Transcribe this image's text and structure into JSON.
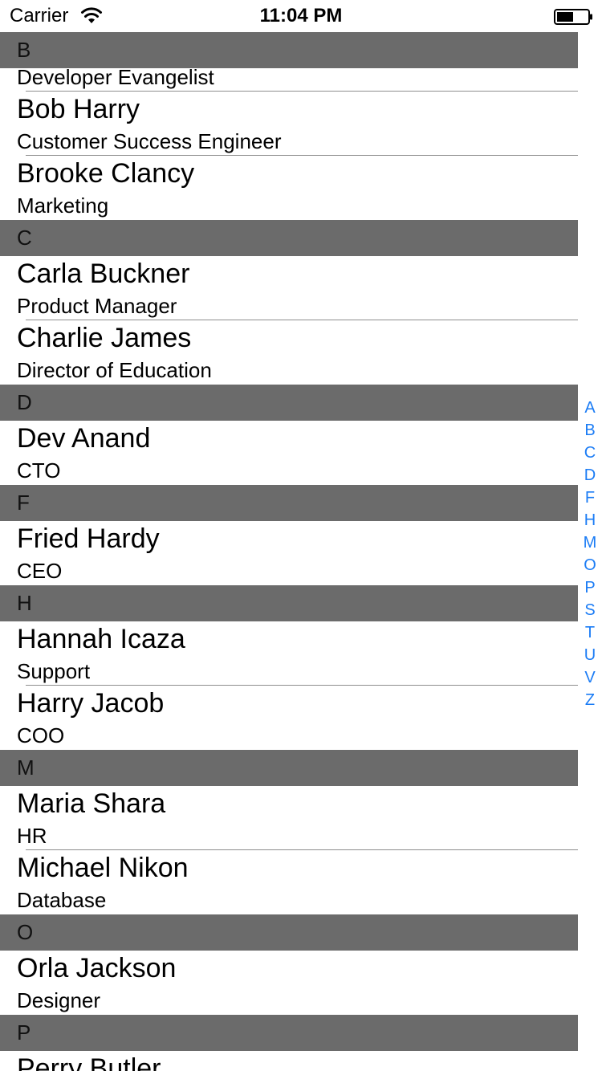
{
  "status_bar": {
    "carrier": "Carrier",
    "time": "11:04 PM",
    "wifi_icon": "wifi-icon",
    "battery_icon": "battery-icon"
  },
  "colors": {
    "section_header_bg": "#6b6b6b",
    "index_accent": "#1b7cf5",
    "separator": "#8e8e8e"
  },
  "list": {
    "top_partial_title": "Developer Evangelist",
    "sections": [
      {
        "letter": "B",
        "rows": [
          {
            "name": "Bob Harry",
            "title": "Customer Success Engineer"
          },
          {
            "name": "Brooke Clancy",
            "title": "Marketing"
          }
        ]
      },
      {
        "letter": "C",
        "rows": [
          {
            "name": "Carla Buckner",
            "title": "Product Manager"
          },
          {
            "name": "Charlie James",
            "title": "Director of Education"
          }
        ]
      },
      {
        "letter": "D",
        "rows": [
          {
            "name": "Dev Anand",
            "title": "CTO"
          }
        ]
      },
      {
        "letter": "F",
        "rows": [
          {
            "name": "Fried Hardy",
            "title": "CEO"
          }
        ]
      },
      {
        "letter": "H",
        "rows": [
          {
            "name": "Hannah Icaza",
            "title": "Support"
          },
          {
            "name": "Harry Jacob",
            "title": "COO"
          }
        ]
      },
      {
        "letter": "M",
        "rows": [
          {
            "name": "Maria Shara",
            "title": "HR"
          },
          {
            "name": "Michael Nikon",
            "title": "Database"
          }
        ]
      },
      {
        "letter": "O",
        "rows": [
          {
            "name": "Orla Jackson",
            "title": "Designer"
          }
        ]
      },
      {
        "letter": "P",
        "rows": [
          {
            "name": "Perry Butler",
            "title": ""
          }
        ]
      }
    ]
  },
  "index": [
    "A",
    "B",
    "C",
    "D",
    "F",
    "H",
    "M",
    "O",
    "P",
    "S",
    "T",
    "U",
    "V",
    "Z"
  ]
}
